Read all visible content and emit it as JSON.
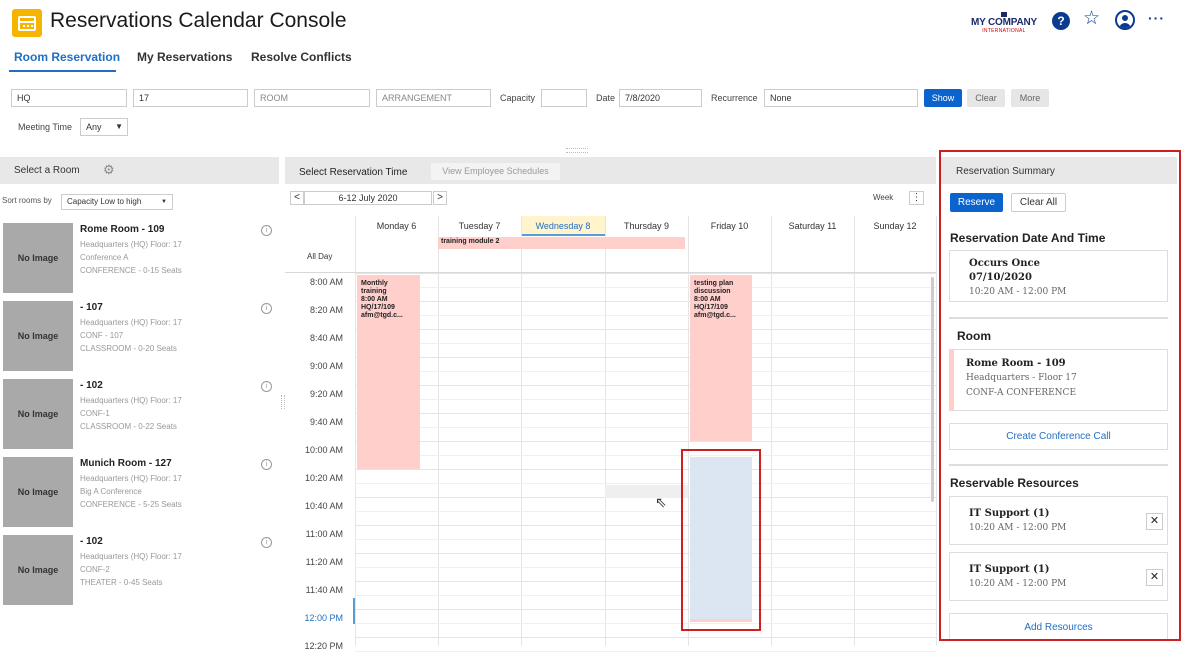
{
  "header": {
    "title": "Reservations Calendar Console",
    "company_name": "MY COMPANY",
    "company_sub": "INTERNATIONAL",
    "help_glyph": "?",
    "star_glyph": "☆",
    "more_glyph": "···"
  },
  "tabs": [
    {
      "label": "Room Reservation",
      "active": true
    },
    {
      "label": "My Reservations",
      "active": false
    },
    {
      "label": "Resolve Conflicts",
      "active": false
    }
  ],
  "filters": {
    "site": "HQ",
    "floor": "17",
    "room_placeholder": "ROOM",
    "arrangement_placeholder": "ARRANGEMENT",
    "capacity_label": "Capacity",
    "capacity_value": "",
    "date_label": "Date",
    "date_value": "7/8/2020",
    "recurrence_label": "Recurrence",
    "recurrence_value": "None",
    "show_label": "Show",
    "clear_label": "Clear",
    "more_label": "More",
    "meeting_time_label": "Meeting Time",
    "meeting_time_value": "Any"
  },
  "left_panel": {
    "title": "Select a Room",
    "sort_label": "Sort rooms by",
    "sort_value": "Capacity  Low to high",
    "no_image": "No Image",
    "info_glyph": "i",
    "rooms": [
      {
        "name": "Rome Room - 109",
        "location": "Headquarters (HQ) Floor: 17",
        "code": "Conference A",
        "detail": "CONFERENCE  -  0-15 Seats"
      },
      {
        "name": " - 107",
        "location": "Headquarters (HQ) Floor: 17",
        "code": "CONF - 107",
        "detail": "CLASSROOM  -  0-20 Seats"
      },
      {
        "name": " - 102",
        "location": "Headquarters (HQ) Floor: 17",
        "code": "CONF-1",
        "detail": "CLASSROOM  -  0-22 Seats"
      },
      {
        "name": "Munich Room - 127",
        "location": "Headquarters (HQ) Floor: 17",
        "code": "Big A Conference",
        "detail": "CONFERENCE  -  5-25 Seats"
      },
      {
        "name": " - 102",
        "location": "Headquarters (HQ) Floor: 17",
        "code": "CONF-2",
        "detail": "THEATER  -  0-45 Seats"
      }
    ]
  },
  "calendar": {
    "title": "Select Reservation Time",
    "view_schedules_label": "View Employee Schedules",
    "prev_glyph": "<",
    "next_glyph": ">",
    "range_label": "6-12 July 2020",
    "view_mode": "Week",
    "kebab_glyph": "⋮",
    "allday_label": "All Day",
    "days": [
      "Monday 6",
      "Tuesday 7",
      "Wednesday 8",
      "Thursday 9",
      "Friday 10",
      "Saturday 11",
      "Sunday 12"
    ],
    "times": [
      "8:00 AM",
      "8:20 AM",
      "8:40 AM",
      "9:00 AM",
      "9:20 AM",
      "9:40 AM",
      "10:00 AM",
      "10:20 AM",
      "10:40 AM",
      "11:00 AM",
      "11:20 AM",
      "11:40 AM",
      "12:00 PM",
      "12:20 PM"
    ],
    "allday_event": "training module 2",
    "event_monday": [
      "Monthly",
      "training",
      "8:00 AM",
      "HQ/17/109",
      "afm@tgd.c..."
    ],
    "event_friday": [
      "testing plan",
      "discussion",
      "8:00 AM",
      "HQ/17/109",
      "afm@tgd.c..."
    ]
  },
  "summary": {
    "title": "Reservation Summary",
    "reserve_label": "Reserve",
    "clear_all_label": "Clear All",
    "date_time_title": "Reservation Date And Time",
    "occurs": "Occurs Once",
    "date": "07/10/2020",
    "time": "10:20 AM - 12:00 PM",
    "room_title": "Room",
    "room_name": "Rome Room - 109",
    "room_location": "Headquarters - Floor 17",
    "room_type": "CONF-A CONFERENCE",
    "create_call_label": "Create Conference Call",
    "resources_title": "Reservable Resources",
    "resources": [
      {
        "name": "IT Support (1)",
        "time": "10:20 AM - 12:00 PM"
      },
      {
        "name": "IT Support (1)",
        "time": "10:20 AM - 12:00 PM"
      }
    ],
    "close_glyph": "✕",
    "add_resources_label": "Add Resources"
  },
  "colors": {
    "accent": "#0b63ce",
    "event": "#ffcfcc",
    "selection": "#dbe6f2",
    "highlight": "#cc1f1f",
    "today_header": "#fff4cc"
  }
}
